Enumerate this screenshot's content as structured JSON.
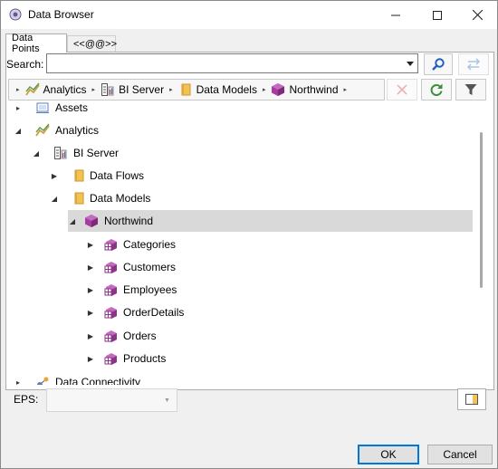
{
  "window": {
    "title": "Data Browser"
  },
  "tabs": [
    {
      "label": "Data Points"
    },
    {
      "label": "<<@@>>"
    }
  ],
  "search": {
    "label": "Search:",
    "value": ""
  },
  "breadcrumb": [
    {
      "label": "Analytics",
      "icon": "analytics-icon"
    },
    {
      "label": "BI Server",
      "icon": "server-icon"
    },
    {
      "label": "Data Models",
      "icon": "folder-icon"
    },
    {
      "label": "Northwind",
      "icon": "cube-icon"
    }
  ],
  "tree": {
    "assets": "Assets",
    "analytics": "Analytics",
    "bi_server": "BI Server",
    "data_flows": "Data Flows",
    "data_models": "Data Models",
    "northwind": "Northwind",
    "tables": [
      "Categories",
      "Customers",
      "Employees",
      "OrderDetails",
      "Orders",
      "Products"
    ],
    "data_connectivity": "Data Connectivity"
  },
  "eps": {
    "label": "EPS:",
    "value": ""
  },
  "buttons": {
    "ok": "OK",
    "cancel": "Cancel"
  },
  "colors": {
    "accent": "#0078d7",
    "folder": "#f3c254",
    "cube": "#a63c9f",
    "refresh": "#3c8d3c",
    "search_icon": "#1f5fbf"
  }
}
